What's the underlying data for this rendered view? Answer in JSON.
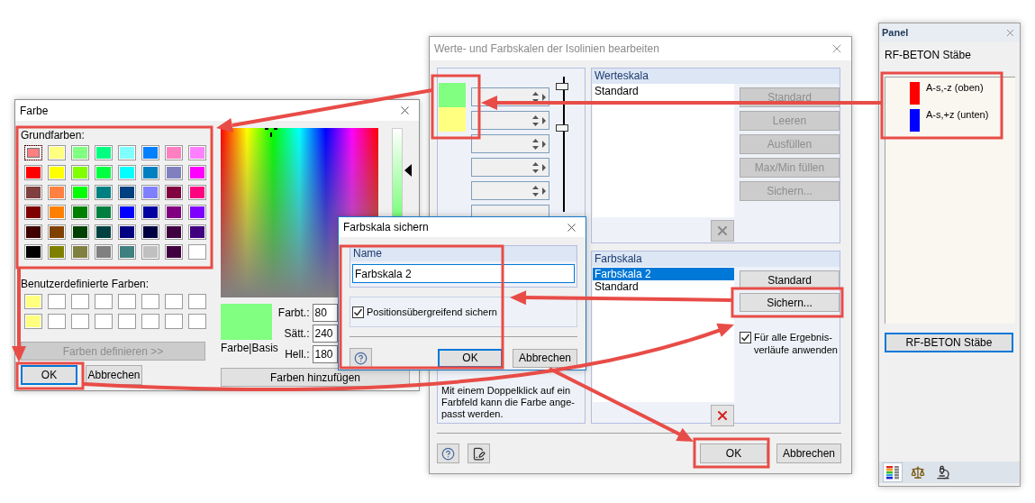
{
  "farbe_dialog": {
    "title": "Farbe",
    "basic_label": "Grundfarben:",
    "basic_colors": [
      {
        "color": "#ff8080",
        "selected": true
      },
      {
        "color": "#ffff80",
        "selected": false
      },
      {
        "color": "#80ff80",
        "selected": false
      },
      {
        "color": "#00ff80",
        "selected": false
      },
      {
        "color": "#80ffff",
        "selected": false
      },
      {
        "color": "#0080ff",
        "selected": false
      },
      {
        "color": "#ff80c0",
        "selected": false
      },
      {
        "color": "#ff80ff",
        "selected": false
      },
      {
        "color": "#ff0000",
        "selected": false
      },
      {
        "color": "#ffff00",
        "selected": false
      },
      {
        "color": "#80ff00",
        "selected": false
      },
      {
        "color": "#00ff40",
        "selected": false
      },
      {
        "color": "#00ffff",
        "selected": false
      },
      {
        "color": "#0080c0",
        "selected": false
      },
      {
        "color": "#8080c0",
        "selected": false
      },
      {
        "color": "#ff00ff",
        "selected": false
      },
      {
        "color": "#804040",
        "selected": false
      },
      {
        "color": "#ff8040",
        "selected": false
      },
      {
        "color": "#00ff00",
        "selected": false
      },
      {
        "color": "#008080",
        "selected": false
      },
      {
        "color": "#004080",
        "selected": false
      },
      {
        "color": "#8080ff",
        "selected": false
      },
      {
        "color": "#800040",
        "selected": false
      },
      {
        "color": "#ff0080",
        "selected": false
      },
      {
        "color": "#800000",
        "selected": false
      },
      {
        "color": "#ff8000",
        "selected": false
      },
      {
        "color": "#008000",
        "selected": false
      },
      {
        "color": "#008040",
        "selected": false
      },
      {
        "color": "#0000ff",
        "selected": false
      },
      {
        "color": "#0000a0",
        "selected": false
      },
      {
        "color": "#800080",
        "selected": false
      },
      {
        "color": "#8000ff",
        "selected": false
      },
      {
        "color": "#400000",
        "selected": false
      },
      {
        "color": "#804000",
        "selected": false
      },
      {
        "color": "#004000",
        "selected": false
      },
      {
        "color": "#004040",
        "selected": false
      },
      {
        "color": "#000080",
        "selected": false
      },
      {
        "color": "#000040",
        "selected": false
      },
      {
        "color": "#400040",
        "selected": false
      },
      {
        "color": "#400080",
        "selected": false
      },
      {
        "color": "#000000",
        "selected": false
      },
      {
        "color": "#808000",
        "selected": false
      },
      {
        "color": "#808040",
        "selected": false
      },
      {
        "color": "#808080",
        "selected": false
      },
      {
        "color": "#408080",
        "selected": false
      },
      {
        "color": "#c0c0c0",
        "selected": false
      },
      {
        "color": "#400040",
        "selected": false
      },
      {
        "color": "#ffffff",
        "selected": false
      }
    ],
    "custom_label": "Benutzerdefinierte Farben:",
    "custom_colors": [
      {
        "color": "#ffff80"
      },
      {
        "color": "#ffffff"
      },
      {
        "color": "#ffffff"
      },
      {
        "color": "#ffffff"
      },
      {
        "color": "#ffffff"
      },
      {
        "color": "#ffffff"
      },
      {
        "color": "#ffffff"
      },
      {
        "color": "#ffffff"
      },
      {
        "color": "#ffff80"
      },
      {
        "color": "#ffffff"
      },
      {
        "color": "#ffffff"
      },
      {
        "color": "#ffffff"
      },
      {
        "color": "#ffffff"
      },
      {
        "color": "#ffffff"
      },
      {
        "color": "#ffffff"
      },
      {
        "color": "#ffffff"
      }
    ],
    "define_button": {
      "label": "Farben definieren >>",
      "disabled": true
    },
    "ok": "OK",
    "cancel": "Abbrechen",
    "preview_label": "Farbe|Basis",
    "fields": [
      {
        "label": "Farbt.:",
        "value": "80"
      },
      {
        "label": "Sätt.:",
        "value": "240"
      },
      {
        "label": "Hell.:",
        "value": "180"
      }
    ],
    "add_button": "Farben hinzufügen"
  },
  "isolines_dialog": {
    "title": "Werte- und Farbskalen der Isolinien bearbeiten",
    "scale_colors": [
      {
        "color": "#80ff80"
      },
      {
        "color": "#ffff80"
      }
    ],
    "slider_thumbs": [
      {
        "level": 0.95
      },
      {
        "level": 0.62
      }
    ],
    "hint": "Mit einem Doppelklick auf ein\nFarbfeld kann die Farbe ange-\npasst werden.",
    "werteskala": {
      "title": "Werteskala",
      "items": [
        {
          "label": "Standard",
          "selected": false
        }
      ],
      "buttons": [
        {
          "label": "Standard",
          "disabled": true
        },
        {
          "label": "Leeren",
          "disabled": true
        },
        {
          "label": "Ausfüllen",
          "disabled": true
        },
        {
          "label": "Max/Min füllen",
          "disabled": true
        },
        {
          "label": "Sichern...",
          "disabled": true
        }
      ],
      "delete_disabled": true
    },
    "farbskala": {
      "title": "Farbskala",
      "items": [
        {
          "label": "Farbskala 2",
          "selected": true
        },
        {
          "label": "Standard",
          "selected": false
        }
      ],
      "buttons": [
        {
          "label": "Standard",
          "disabled": false
        },
        {
          "label": "Sichern...",
          "disabled": false
        }
      ],
      "delete_disabled": false,
      "apply_all": {
        "label": "Für alle Ergebnis-\nverläufe anwenden",
        "checked": true
      }
    },
    "ok": "OK",
    "cancel": "Abbrechen"
  },
  "save_dialog": {
    "title": "Farbskala sichern",
    "name_label": "Name",
    "name_value": "Farbskala 2",
    "cross_position": {
      "label": "Positionsübergreifend sichern",
      "checked": true
    },
    "ok": "OK",
    "cancel": "Abbrechen"
  },
  "panel": {
    "title": "Panel",
    "heading": "RF-BETON Stäbe",
    "legend": [
      {
        "label": "A-s,-z (oben)",
        "color": "#ff0000"
      },
      {
        "label": "A-s,+z (unten)",
        "color": "#0000ff"
      }
    ],
    "button": "RF-BETON Stäbe",
    "tabs": [
      {
        "kind": "legend",
        "selected": true
      },
      {
        "kind": "balance",
        "selected": false
      },
      {
        "kind": "microscope",
        "selected": false
      }
    ]
  }
}
